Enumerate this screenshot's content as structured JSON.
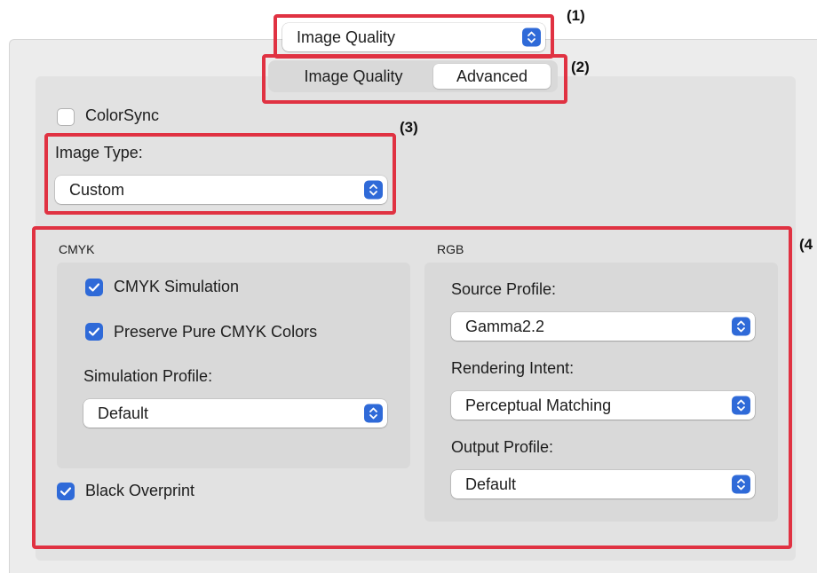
{
  "top_popup": {
    "value": "Image Quality"
  },
  "tabs": [
    {
      "label": "Image Quality",
      "selected": false
    },
    {
      "label": "Advanced",
      "selected": true
    }
  ],
  "colorsync": {
    "label": "ColorSync",
    "checked": false
  },
  "image_type": {
    "label": "Image Type:",
    "value": "Custom"
  },
  "cmyk": {
    "heading": "CMYK",
    "simulation": {
      "label": "CMYK Simulation",
      "checked": true
    },
    "preserve": {
      "label": "Preserve Pure CMYK Colors",
      "checked": true
    },
    "profile_label": "Simulation Profile:",
    "profile_value": "Default"
  },
  "black_overprint": {
    "label": "Black Overprint",
    "checked": true
  },
  "rgb": {
    "heading": "RGB",
    "source_label": "Source Profile:",
    "source_value": "Gamma2.2",
    "intent_label": "Rendering Intent:",
    "intent_value": "Perceptual Matching",
    "output_label": "Output Profile:",
    "output_value": "Default"
  },
  "callouts": [
    "(1)",
    "(2)",
    "(3)",
    "(4"
  ],
  "colors": {
    "accent": "#2f6ad8",
    "callout_red": "#e03242"
  }
}
